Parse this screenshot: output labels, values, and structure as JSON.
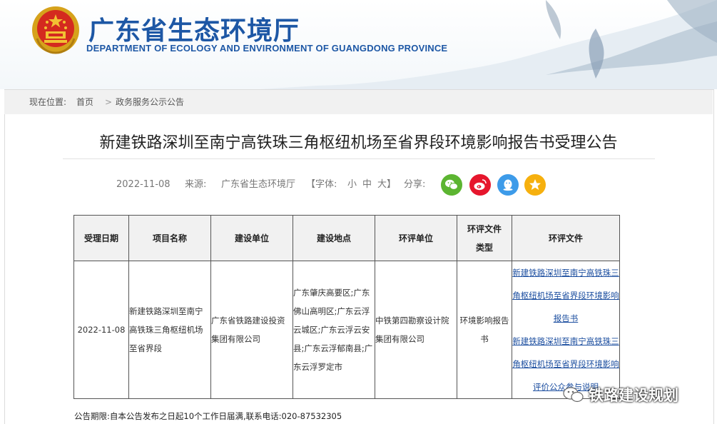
{
  "site": {
    "name_cn": "广东省生态环境厅",
    "name_en": "DEPARTMENT OF ECOLOGY AND ENVIRONMENT OF GUANGDONG PROVINCE"
  },
  "breadcrumb": {
    "prefix": "现在位置:",
    "home": "首页",
    "separator": ">",
    "current": "政务服务公示公告"
  },
  "article": {
    "title": "新建铁路深圳至南宁高铁珠三角枢纽机场至省界段环境影响报告书受理公告",
    "date": "2022-11-08",
    "source_label": "来源:",
    "source": "广东省生态环境厅",
    "font_size_label": "【字体:",
    "font_small": "小",
    "font_medium": "中",
    "font_large": "大】",
    "share_label": "分享:"
  },
  "share_icons": [
    "wechat-icon",
    "weibo-icon",
    "qq-icon",
    "qzone-icon"
  ],
  "colors": {
    "brand": "#1d57a5",
    "wechat": "#5cb531",
    "weibo": "#e6162d",
    "qq": "#3d9be9",
    "qzone": "#f6b00e"
  },
  "table": {
    "headers": {
      "date": "受理日期",
      "project": "项目名称",
      "builder": "建设单位",
      "location": "建设地点",
      "eia_unit": "环评单位",
      "doc_type_1": "环评文件",
      "doc_type_2": "类型",
      "docs": "环评文件"
    },
    "row": {
      "date": "2022-11-08",
      "project": "新建铁路深圳至南宁高铁珠三角枢纽机场至省界段",
      "builder": "广东省铁路建设投资集团有限公司",
      "location": "广东肇庆高要区;广东佛山高明区;广东云浮云城区;广东云浮云安县;广东云浮郁南县;广东云浮罗定市",
      "eia_unit": "中铁第四勘察设计院集团有限公司",
      "doc_type": "环境影响报告书",
      "doc_link_1": "新建铁路深圳至南宁高铁珠三角枢纽机场至省界段环境影响报告书",
      "doc_link_2": "新建铁路深圳至南宁高铁珠三角枢纽机场至省界段环境影响评价公众参与说明"
    }
  },
  "notice": "公告期限:自本公告发布之日起10个工作日届满,联系电话:020-87532305",
  "watermark": "铁路建设规划"
}
